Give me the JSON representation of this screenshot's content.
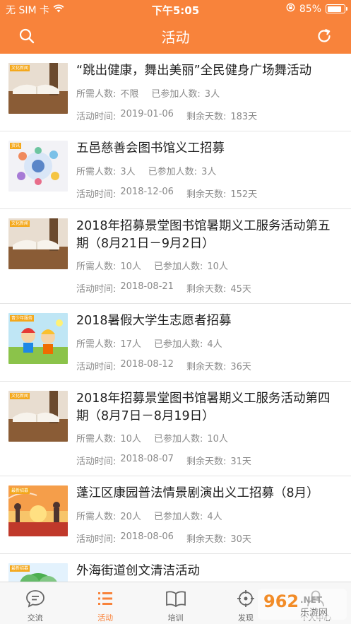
{
  "status_bar": {
    "carrier": "无 SIM 卡",
    "time": "下午5:05",
    "battery": "85%",
    "battery_level": 0.85
  },
  "header": {
    "title": "活动",
    "left_icon": "search-icon",
    "right_icon": "refresh-icon"
  },
  "activities": [
    {
      "tag": "文化新闻",
      "title": "“跳出健康，舞出美丽”全民健身广场舞活动",
      "required_label": "所需人数:",
      "required": "不限",
      "joined_label": "已参加人数:",
      "joined": "3人",
      "date_label": "活动时间:",
      "date": "2019-01-06",
      "remaining_label": "剩余天数:",
      "remaining": "183天",
      "thumb": "book-cafe"
    },
    {
      "tag": "资讯",
      "title": "五邑慈善会图书馆义工招募",
      "required_label": "所需人数:",
      "required": "3人",
      "joined_label": "已参加人数:",
      "joined": "3人",
      "date_label": "活动时间:",
      "date": "2018-12-06",
      "remaining_label": "剩余天数:",
      "remaining": "152天",
      "thumb": "digital"
    },
    {
      "tag": "文化新闻",
      "title": "2018年招募景堂图书馆暑期义工服务活动第五期（8月21日－9月2日）",
      "required_label": "所需人数:",
      "required": "10人",
      "joined_label": "已参加人数:",
      "joined": "10人",
      "date_label": "活动时间:",
      "date": "2018-08-21",
      "remaining_label": "剩余天数:",
      "remaining": "45天",
      "thumb": "book-cafe"
    },
    {
      "tag": "青少年服务",
      "title": "2018暑假大学生志愿者招募",
      "required_label": "所需人数:",
      "required": "17人",
      "joined_label": "已参加人数:",
      "joined": "4人",
      "date_label": "活动时间:",
      "date": "2018-08-12",
      "remaining_label": "剩余天数:",
      "remaining": "36天",
      "thumb": "kids"
    },
    {
      "tag": "文化新闻",
      "title": "2018年招募景堂图书馆暑期义工服务活动第四期（8月7日－8月19日）",
      "required_label": "所需人数:",
      "required": "10人",
      "joined_label": "已参加人数:",
      "joined": "10人",
      "date_label": "活动时间:",
      "date": "2018-08-07",
      "remaining_label": "剩余天数:",
      "remaining": "31天",
      "thumb": "book-cafe"
    },
    {
      "tag": "最新招募",
      "title": "蓬江区康园普法情景剧演出义工招募（8月）",
      "required_label": "所需人数:",
      "required": "20人",
      "joined_label": "已参加人数:",
      "joined": "4人",
      "date_label": "活动时间:",
      "date": "2018-08-06",
      "remaining_label": "剩余天数:",
      "remaining": "30天",
      "thumb": "sunset"
    },
    {
      "tag": "最新招募",
      "title": "外海街道创文清洁活动",
      "thumb": "tree"
    }
  ],
  "tabbar": {
    "tabs": [
      {
        "label": "交流",
        "icon": "chat-icon"
      },
      {
        "label": "活动",
        "icon": "list-icon",
        "active": true
      },
      {
        "label": "培训",
        "icon": "book-icon"
      },
      {
        "label": "发现",
        "icon": "crosshair-icon"
      },
      {
        "label": "个人中心",
        "icon": "user-icon"
      }
    ]
  },
  "watermark": {
    "brand": "962.NET",
    "sub": "乐游网"
  },
  "colors": {
    "accent": "#f8833b",
    "text": "#222222",
    "muted": "#8a8a8a",
    "divider": "#e4e4e4"
  }
}
